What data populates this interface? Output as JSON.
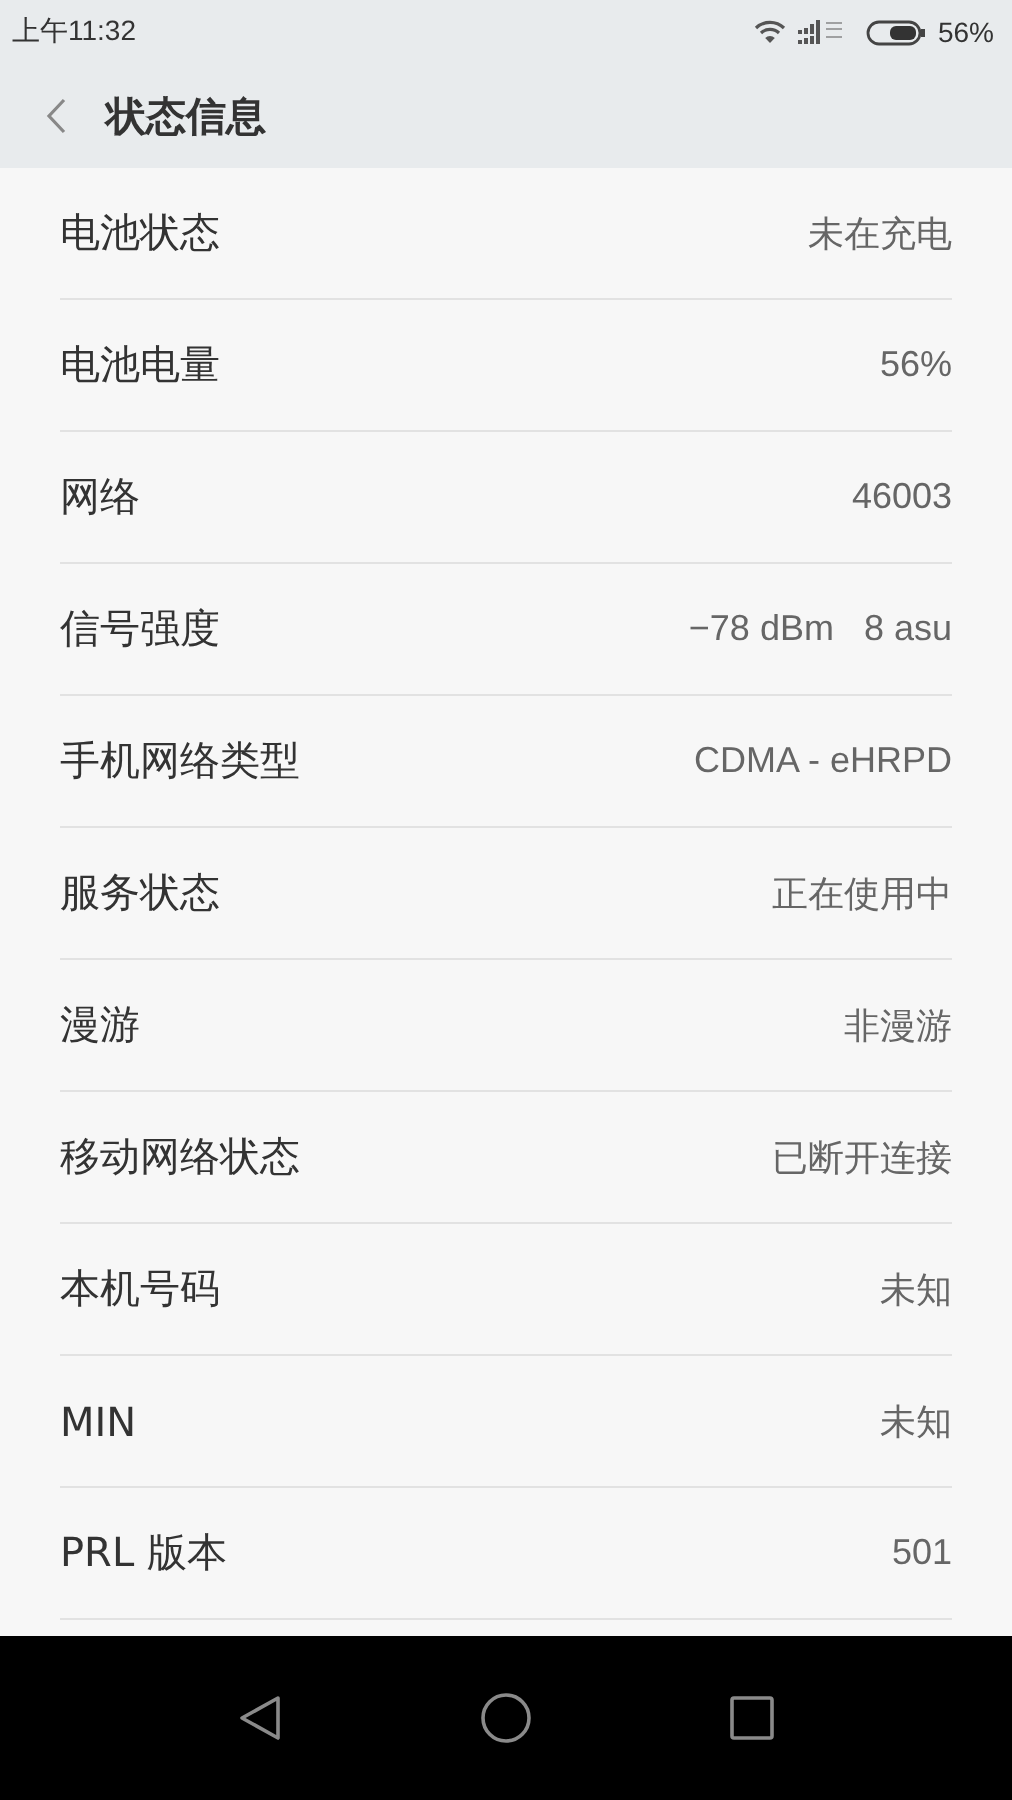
{
  "status_bar": {
    "time": "上午11:32",
    "battery_percent": "56%"
  },
  "header": {
    "title": "状态信息"
  },
  "rows": [
    {
      "label": "电池状态",
      "value": "未在充电"
    },
    {
      "label": "电池电量",
      "value": "56%"
    },
    {
      "label": "网络",
      "value": "46003"
    },
    {
      "label": "信号强度",
      "value": "−78 dBm   8 asu"
    },
    {
      "label": "手机网络类型",
      "value": "CDMA - eHRPD"
    },
    {
      "label": "服务状态",
      "value": "正在使用中"
    },
    {
      "label": "漫游",
      "value": "非漫游"
    },
    {
      "label": "移动网络状态",
      "value": "已断开连接"
    },
    {
      "label": "本机号码",
      "value": "未知"
    },
    {
      "label": "MIN",
      "value": "未知"
    },
    {
      "label": "PRL 版本",
      "value": "501"
    }
  ]
}
